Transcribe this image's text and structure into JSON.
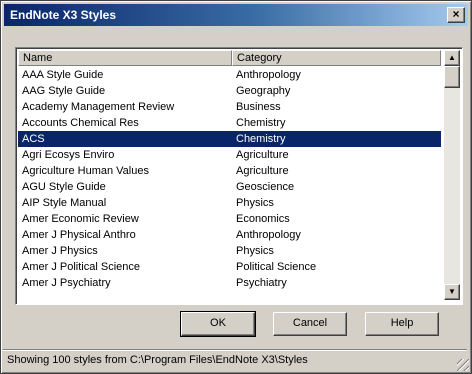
{
  "window": {
    "title": "EndNote X3 Styles",
    "close_glyph": "×"
  },
  "list": {
    "headers": {
      "name": "Name",
      "category": "Category"
    },
    "rows": [
      {
        "name": "AAA Style Guide",
        "category": "Anthropology"
      },
      {
        "name": "AAG Style Guide",
        "category": "Geography"
      },
      {
        "name": "Academy Management Review",
        "category": "Business"
      },
      {
        "name": "Accounts Chemical Res",
        "category": "Chemistry"
      },
      {
        "name": "ACS",
        "category": "Chemistry",
        "selected": true
      },
      {
        "name": "Agri Ecosys Enviro",
        "category": "Agriculture"
      },
      {
        "name": "Agriculture Human Values",
        "category": "Agriculture"
      },
      {
        "name": "AGU Style Guide",
        "category": "Geoscience"
      },
      {
        "name": "AIP Style Manual",
        "category": "Physics"
      },
      {
        "name": "Amer Economic Review",
        "category": "Economics"
      },
      {
        "name": "Amer J Physical Anthro",
        "category": "Anthropology"
      },
      {
        "name": "Amer J Physics",
        "category": "Physics"
      },
      {
        "name": "Amer J Political Science",
        "category": "Political Science"
      },
      {
        "name": "Amer J Psychiatry",
        "category": "Psychiatry"
      }
    ],
    "scroll_up_glyph": "▲",
    "scroll_down_glyph": "▼"
  },
  "buttons": {
    "ok": "OK",
    "cancel": "Cancel",
    "help": "Help"
  },
  "status": {
    "text": "Showing 100 styles from C:\\Program Files\\EndNote X3\\Styles"
  },
  "colors": {
    "selection": "#0a246a",
    "titlebar_start": "#0a246a",
    "face": "#d4d0c8"
  }
}
